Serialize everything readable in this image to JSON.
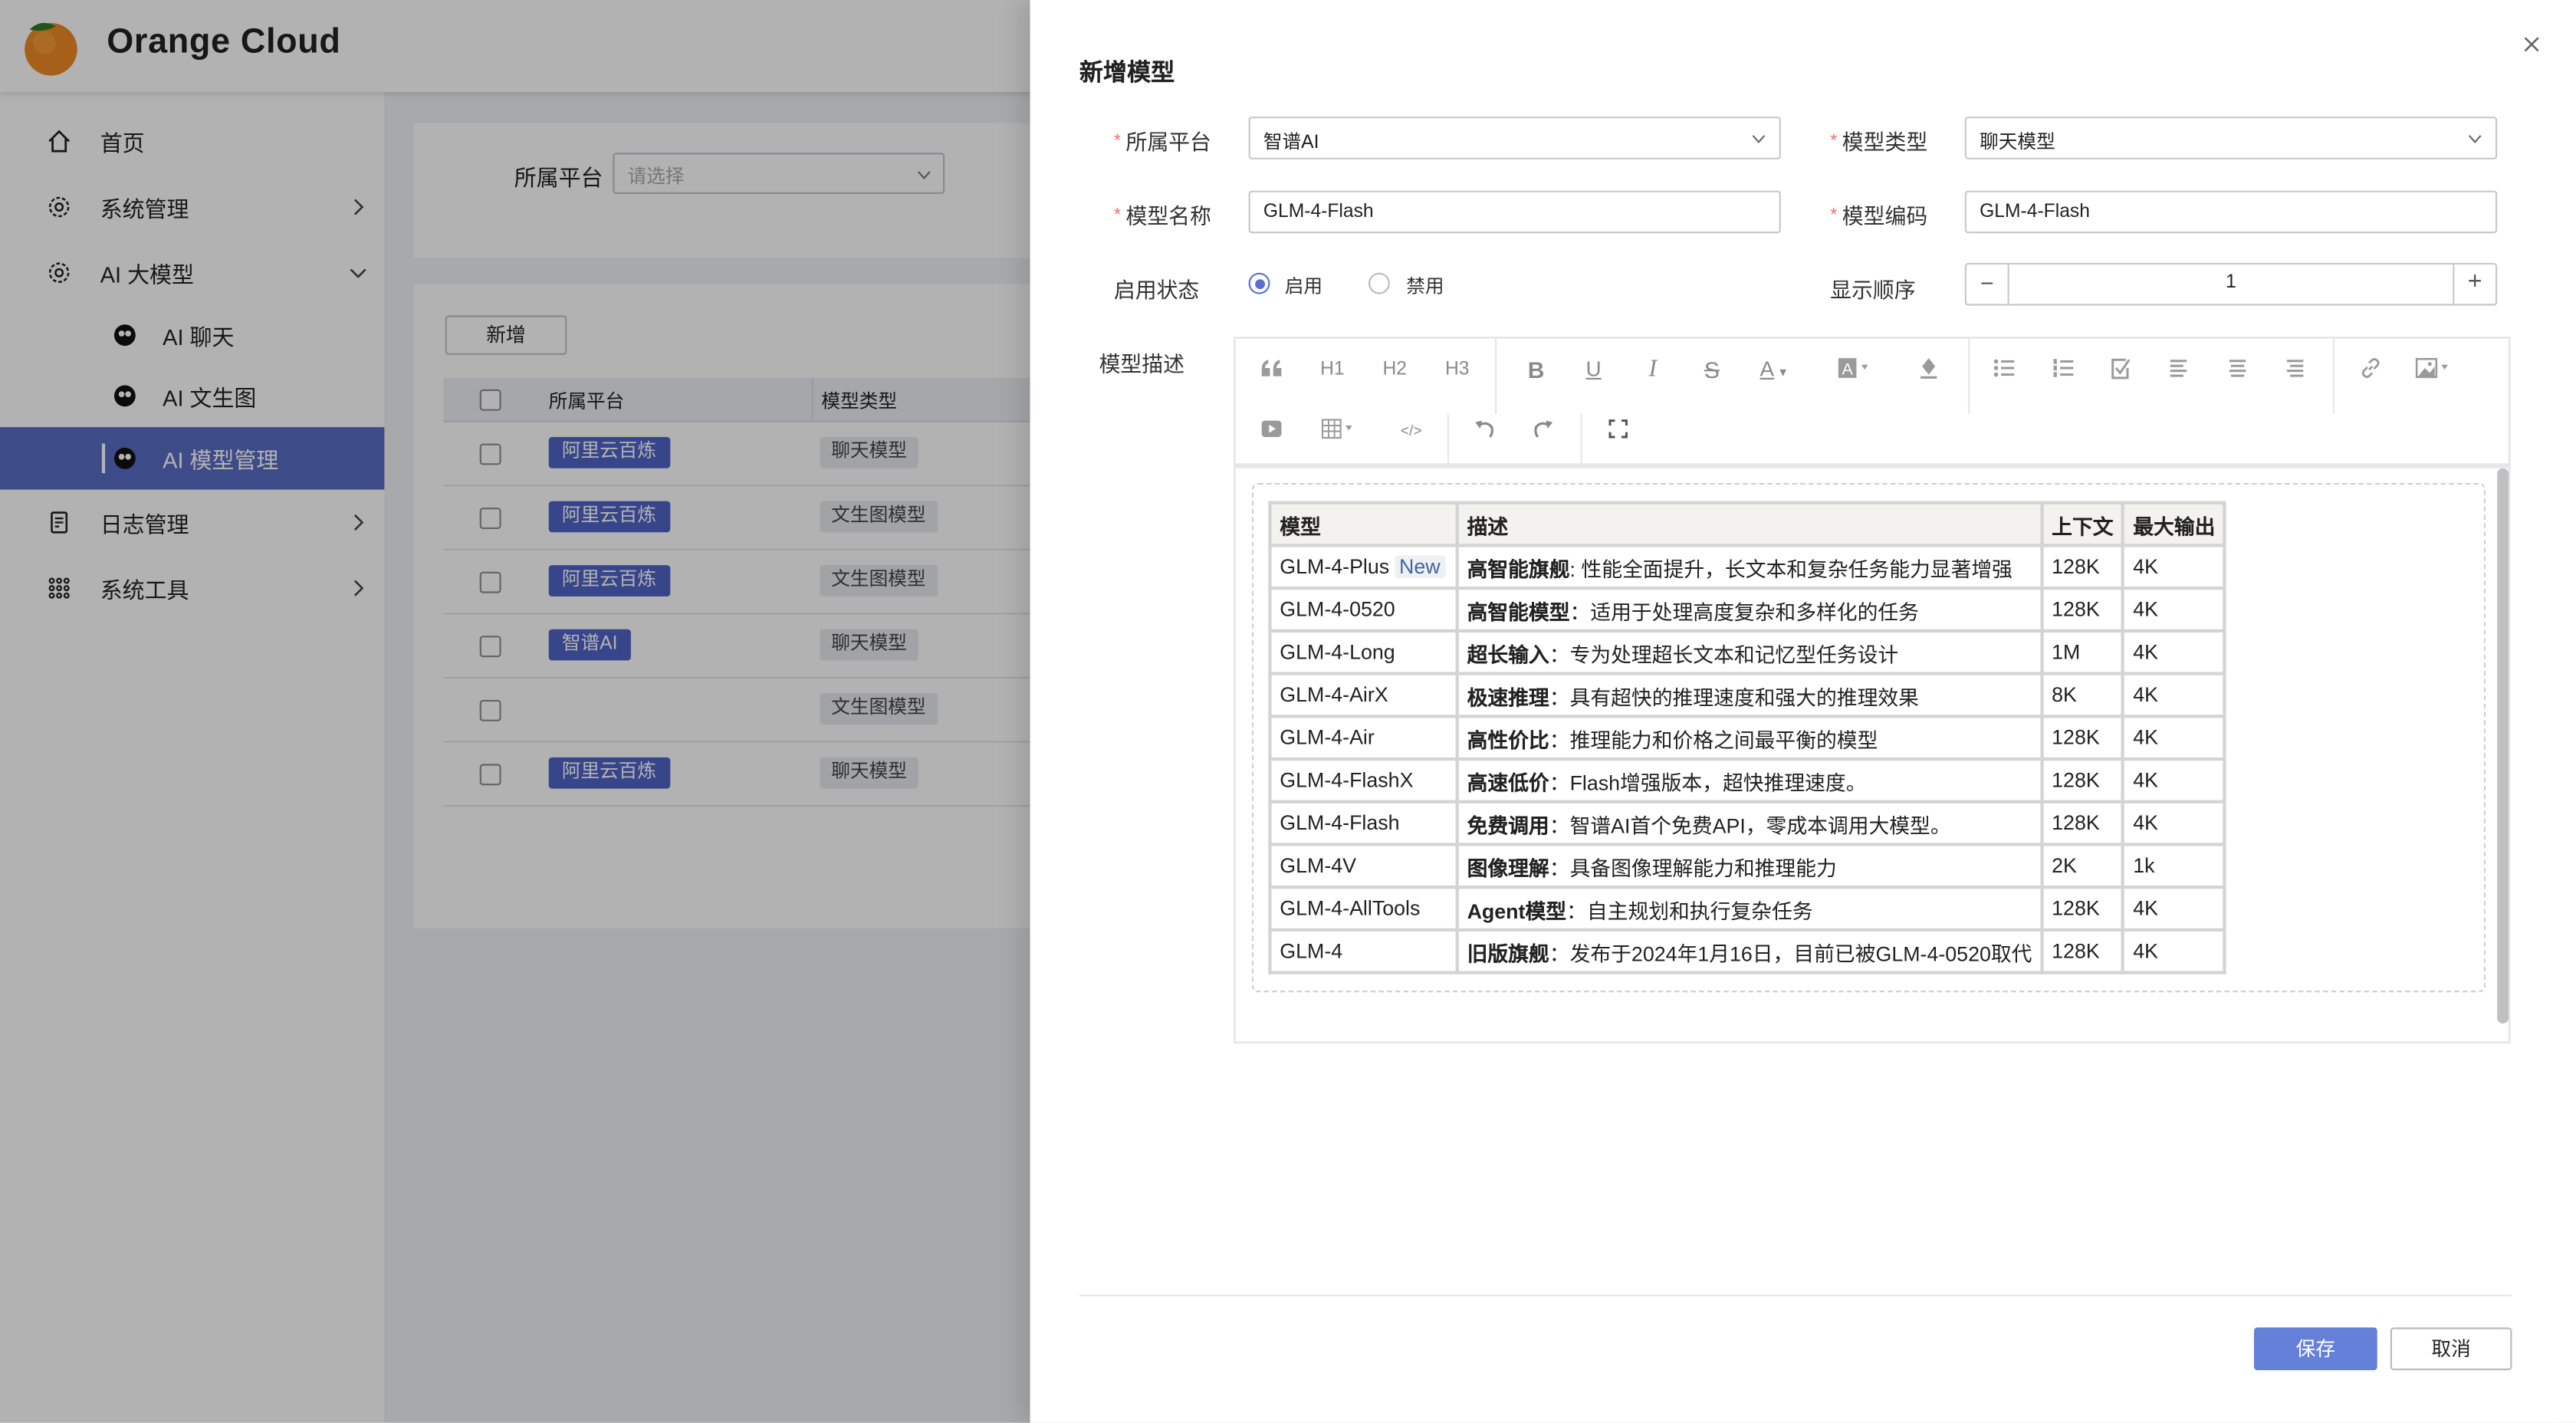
{
  "app": {
    "title": "Orange Cloud"
  },
  "sidebar": {
    "items": [
      {
        "label": "首页",
        "icon": "home-icon"
      },
      {
        "label": "系统管理",
        "icon": "gear-icon",
        "expanded": false
      },
      {
        "label": "AI 大模型",
        "icon": "gear-icon",
        "expanded": true
      },
      {
        "label": "AI 聊天",
        "icon": "openai-icon",
        "sub": true
      },
      {
        "label": "AI 文生图",
        "icon": "openai-icon",
        "sub": true
      },
      {
        "label": "AI 模型管理",
        "icon": "openai-icon",
        "sub": true,
        "active": true
      },
      {
        "label": "日志管理",
        "icon": "document-icon",
        "expanded": false
      },
      {
        "label": "系统工具",
        "icon": "grid-icon",
        "expanded": false
      }
    ]
  },
  "filter": {
    "label": "所属平台",
    "placeholder": "请选择"
  },
  "list": {
    "add_label": "新增",
    "columns": [
      "所属平台",
      "模型类型"
    ],
    "rows": [
      {
        "platform": "阿里云百炼",
        "type": "聊天模型"
      },
      {
        "platform": "阿里云百炼",
        "type": "文生图模型"
      },
      {
        "platform": "阿里云百炼",
        "type": "文生图模型"
      },
      {
        "platform": "智谱AI",
        "type": "聊天模型"
      },
      {
        "platform": "",
        "type": "文生图模型"
      },
      {
        "platform": "阿里云百炼",
        "type": "聊天模型"
      }
    ]
  },
  "drawer": {
    "title": "新增模型",
    "fields": {
      "platform": {
        "label": "所属平台",
        "value": "智谱AI",
        "required": true
      },
      "type": {
        "label": "模型类型",
        "value": "聊天模型",
        "required": true
      },
      "name": {
        "label": "模型名称",
        "value": "GLM-4-Flash",
        "required": true
      },
      "code": {
        "label": "模型编码",
        "value": "GLM-4-Flash",
        "required": true
      },
      "status": {
        "label": "启用状态",
        "options": [
          "启用",
          "禁用"
        ],
        "selected": "启用"
      },
      "order": {
        "label": "显示顺序",
        "value": "1",
        "minus": "−",
        "plus": "+"
      },
      "description": {
        "label": "模型描述"
      }
    },
    "toolbar": {
      "h1": "H1",
      "h2": "H2",
      "h3": "H3"
    },
    "desc_table": {
      "headers": [
        "模型",
        "描述",
        "上下文",
        "最大输出"
      ],
      "rows": [
        {
          "model": "GLM-4-Plus",
          "tag": "New",
          "bold": "高智能旗舰",
          "sep": ": ",
          "text": "性能全面提升，长文本和复杂任务能力显著增强",
          "ctx": "128K",
          "out": "4K"
        },
        {
          "model": "GLM-4-0520",
          "bold": "高智能模型",
          "sep": "：",
          "text": "适用于处理高度复杂和多样化的任务",
          "ctx": "128K",
          "out": "4K"
        },
        {
          "model": "GLM-4-Long",
          "bold": "超长输入",
          "sep": "：",
          "text": "专为处理超长文本和记忆型任务设计",
          "ctx": "1M",
          "out": "4K"
        },
        {
          "model": "GLM-4-AirX",
          "bold": "极速推理",
          "sep": "：",
          "text": "具有超快的推理速度和强大的推理效果",
          "ctx": "8K",
          "out": "4K"
        },
        {
          "model": "GLM-4-Air",
          "bold": "高性价比",
          "sep": "：",
          "text": "推理能力和价格之间最平衡的模型",
          "ctx": "128K",
          "out": "4K"
        },
        {
          "model": "GLM-4-FlashX",
          "bold": "高速低价",
          "sep": "：",
          "text": "Flash增强版本，超快推理速度。",
          "ctx": "128K",
          "out": "4K"
        },
        {
          "model": "GLM-4-Flash",
          "bold": "免费调用",
          "sep": "：",
          "text": "智谱AI首个免费API，零成本调用大模型。",
          "ctx": "128K",
          "out": "4K"
        },
        {
          "model": "GLM-4V",
          "bold": "图像理解",
          "sep": "：",
          "text": "具备图像理解能力和推理能力",
          "ctx": "2K",
          "out": "1k"
        },
        {
          "model": "GLM-4-AllTools",
          "bold": "Agent模型",
          "sep": "：",
          "text": "自主规划和执行复杂任务",
          "ctx": "128K",
          "out": "4K"
        },
        {
          "model": "GLM-4",
          "bold": "旧版旗舰",
          "sep": "：",
          "text": "发布于2024年1月16日，目前已被GLM-4-0520取代",
          "ctx": "128K",
          "out": "4K"
        }
      ]
    },
    "save_label": "保存",
    "cancel_label": "取消"
  },
  "colors": {
    "accent": "#5a6cc4",
    "primary_button": "#6580d8",
    "required": "#f56c6c"
  }
}
